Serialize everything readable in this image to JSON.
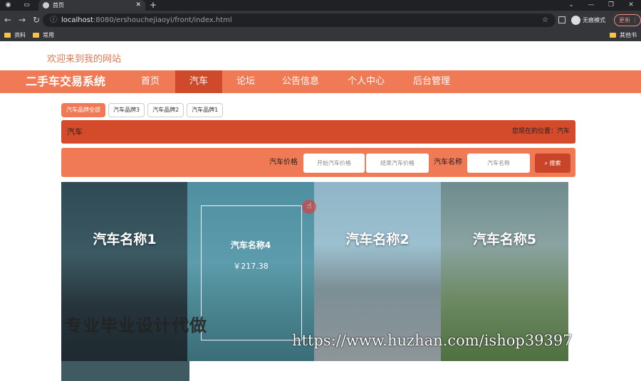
{
  "browser": {
    "tab_title": "首页",
    "url_host": "localhost",
    "url_path": ":8080/ershouchejiaoyi/front/index.html",
    "profile_label": "无痕模式",
    "update_label": "更新",
    "bookmarks": [
      "资料",
      "常用"
    ],
    "other_bookmarks": "其他书签"
  },
  "site": {
    "welcome": "欢迎来到我的网站",
    "brand": "二手车交易系统",
    "nav": [
      "首页",
      "汽车",
      "论坛",
      "公告信息",
      "个人中心",
      "后台管理"
    ],
    "active_nav": "汽车"
  },
  "filters": {
    "tags": [
      "汽车品牌全部",
      "汽车品牌3",
      "汽车品牌2",
      "汽车品牌1"
    ]
  },
  "breadcrumb": {
    "title": "汽车",
    "location": "您现在的位置：汽车"
  },
  "search": {
    "price_label": "汽车价格",
    "min_placeholder": "开始汽车价格",
    "max_placeholder": "结束汽车价格",
    "name_label": "汽车名称",
    "name_placeholder": "汽车名称",
    "button": "搜索"
  },
  "cars": [
    {
      "name": "汽车名称1"
    },
    {
      "name": "汽车名称4",
      "price": "￥217.38"
    },
    {
      "name": "汽车名称2"
    },
    {
      "name": "汽车名称5"
    }
  ],
  "watermarks": {
    "left": "专业毕业设计代做",
    "right": "https://www.huzhan.com/ishop39397"
  },
  "colors": {
    "accent": "#ef7a55",
    "accent_dark": "#d44b2c"
  }
}
